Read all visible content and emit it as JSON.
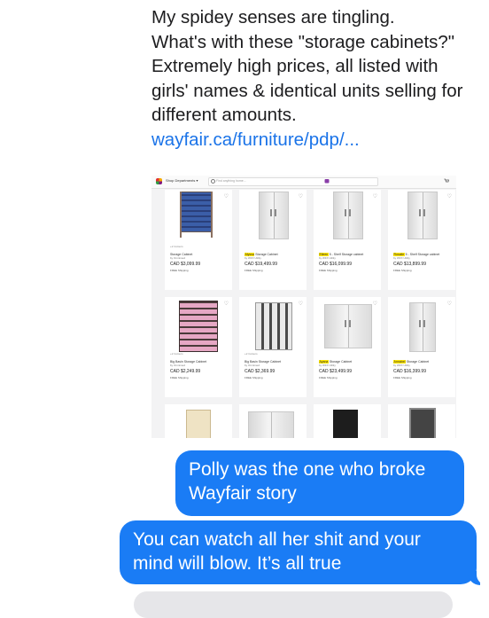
{
  "incoming": {
    "lines": [
      "My spidey senses are tingling.",
      "What's with these \"storage cabinets?\"",
      "Extremely high prices, all listed with",
      "girls' names & identical units selling for",
      "different amounts."
    ],
    "link": "wayfair.ca/furniture/pdp/..."
  },
  "screenshot": {
    "dept_label": "Shop Departments ▾",
    "search_placeholder": "Find anything home...",
    "products": [
      {
        "colors": "+2 Colours",
        "name_prefix": "",
        "name_highlight": "",
        "name_rest": "Storage Cabinet",
        "sub": "by Omnimed",
        "price": "CAD $3,099.99",
        "ship": "FREE Shipping"
      },
      {
        "colors": "",
        "name_prefix": "",
        "name_highlight": "Alyssa",
        "name_rest": " Storage Cabinet",
        "sub": "by WFX Utility",
        "price": "CAD $19,499.99",
        "ship": "FREE Shipping"
      },
      {
        "colors": "",
        "name_prefix": "",
        "name_highlight": "Eileen",
        "name_rest": " 5 - Shelf Storage cabinet",
        "sub": "by WFX Utility",
        "price": "CAD $16,099.99",
        "ship": "FREE Shipping"
      },
      {
        "colors": "",
        "name_prefix": "",
        "name_highlight": "Rosalie",
        "name_rest": " 5 - Shelf Storage cabinet",
        "sub": "by WFX Utility",
        "price": "CAD $13,899.99",
        "ship": "FREE Shipping"
      },
      {
        "colors": "+2 Colours",
        "name_prefix": "",
        "name_highlight": "",
        "name_rest": "Big Basin Storage Cabinet",
        "sub": "by Omnimed",
        "price": "CAD $2,249.99",
        "ship": "FREE Shipping"
      },
      {
        "colors": "+2 Colours",
        "name_prefix": "",
        "name_highlight": "",
        "name_rest": "Big Basin Storage Cabinet",
        "sub": "by Omnimed",
        "price": "CAD $2,369.99",
        "ship": "FREE Shipping"
      },
      {
        "colors": "",
        "name_prefix": "",
        "name_highlight": "Ayana",
        "name_rest": " Storage Cabinet",
        "sub": "by WFX Utility",
        "price": "CAD $23,499.99",
        "ship": "FREE Shipping"
      },
      {
        "colors": "",
        "name_prefix": "",
        "name_highlight": "Annabel",
        "name_rest": " Storage Cabinet",
        "sub": "by WFX Utility",
        "price": "CAD $16,399.99",
        "ship": "FREE Shipping"
      }
    ]
  },
  "outgoing": [
    {
      "lines": [
        "Polly was the one who broke",
        "Wayfair story"
      ]
    },
    {
      "lines": [
        "You can watch all her shit and your",
        "mind will blow. It’s all true"
      ]
    }
  ],
  "colors": {
    "bubble_blue": "#1a7cf5",
    "link_blue": "#1a73e8",
    "highlight": "#ffe600"
  }
}
